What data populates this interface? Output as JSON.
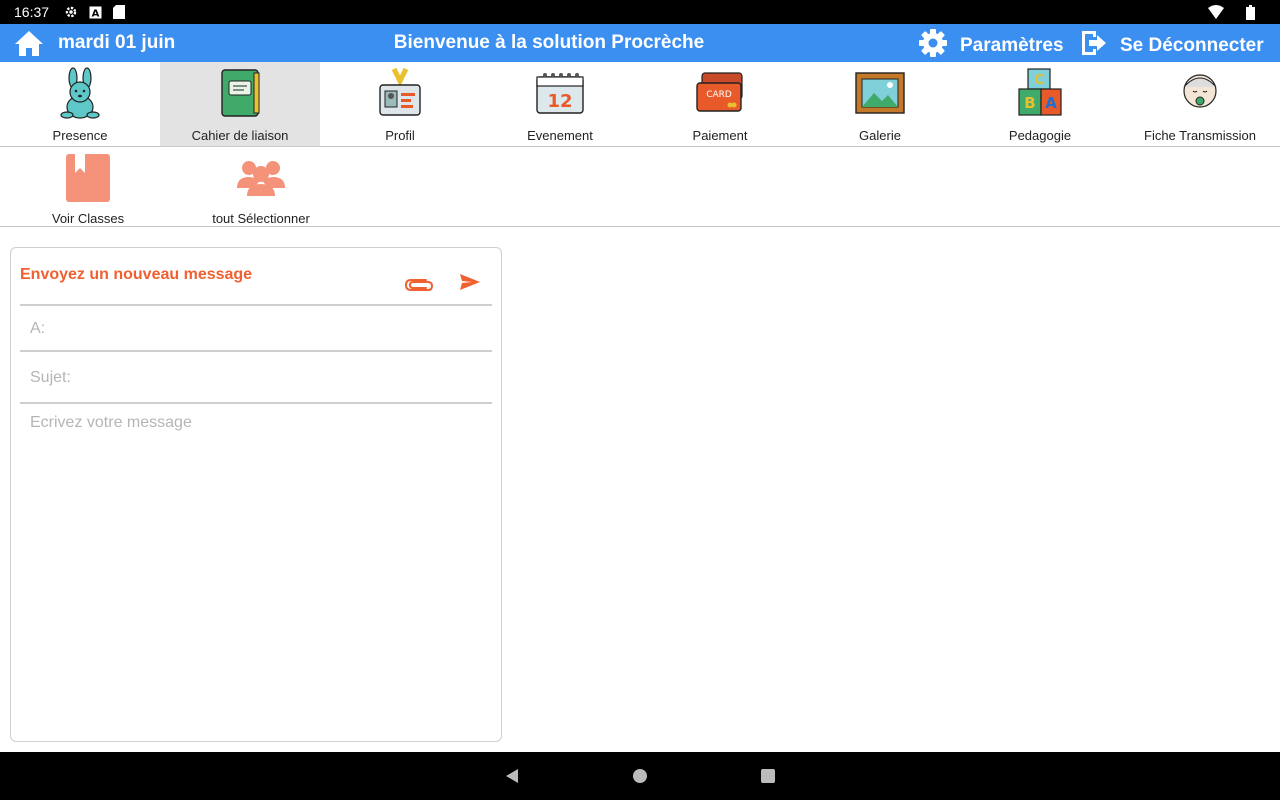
{
  "status_bar": {
    "time": "16:37",
    "icons": [
      "settings-icon",
      "a-icon",
      "sd-card-icon",
      "wifi-icon",
      "battery-icon"
    ]
  },
  "header": {
    "date": "mardi 01 juin",
    "title": "Bienvenue à la solution Procrèche",
    "settings_label": "Paramètres",
    "logout_label": "Se Déconnecter",
    "color": "#3b8ff0"
  },
  "nav": {
    "active": "Cahier de liaison",
    "items": [
      {
        "label": "Presence",
        "icon": "bunny-icon"
      },
      {
        "label": "Cahier de liaison",
        "icon": "notebook-icon"
      },
      {
        "label": "Profil",
        "icon": "id-badge-icon"
      },
      {
        "label": "Evenement",
        "icon": "calendar-icon"
      },
      {
        "label": "Paiement",
        "icon": "credit-card-icon"
      },
      {
        "label": "Galerie",
        "icon": "picture-frame-icon"
      },
      {
        "label": "Pedagogie",
        "icon": "abc-blocks-icon"
      },
      {
        "label": "Fiche Transmission",
        "icon": "baby-face-icon"
      }
    ]
  },
  "subnav": {
    "items": [
      {
        "label": "Voir Classes",
        "icon": "bookmark-book-icon"
      },
      {
        "label": "tout Sélectionner",
        "icon": "group-icon"
      }
    ],
    "accent": "#f4937a"
  },
  "compose": {
    "title": "Envoyez un nouveau message",
    "to_placeholder": "A:",
    "subject_placeholder": "Sujet:",
    "body_placeholder": "Ecrivez votre message",
    "accent": "#f06030"
  },
  "system_nav": {
    "buttons": [
      "back-icon",
      "home-icon",
      "recents-icon"
    ]
  }
}
